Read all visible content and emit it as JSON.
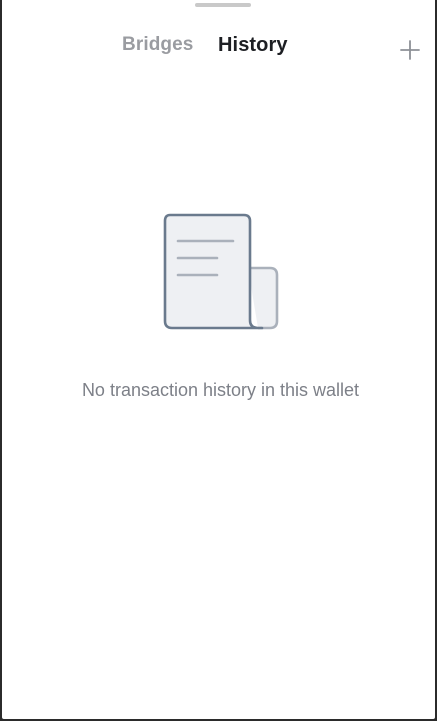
{
  "tabs": [
    {
      "label": "Bridges",
      "active": false
    },
    {
      "label": "History",
      "active": true
    }
  ],
  "actions": {
    "add_icon": "plus-icon"
  },
  "empty_state": {
    "icon": "receipt-document-icon",
    "message": "No transaction history in this wallet"
  },
  "colors": {
    "active_tab": "#1d1f23",
    "inactive_tab": "#9a9ca1",
    "icon_stroke": "#6a7a8d",
    "message_text": "#7d8088"
  }
}
